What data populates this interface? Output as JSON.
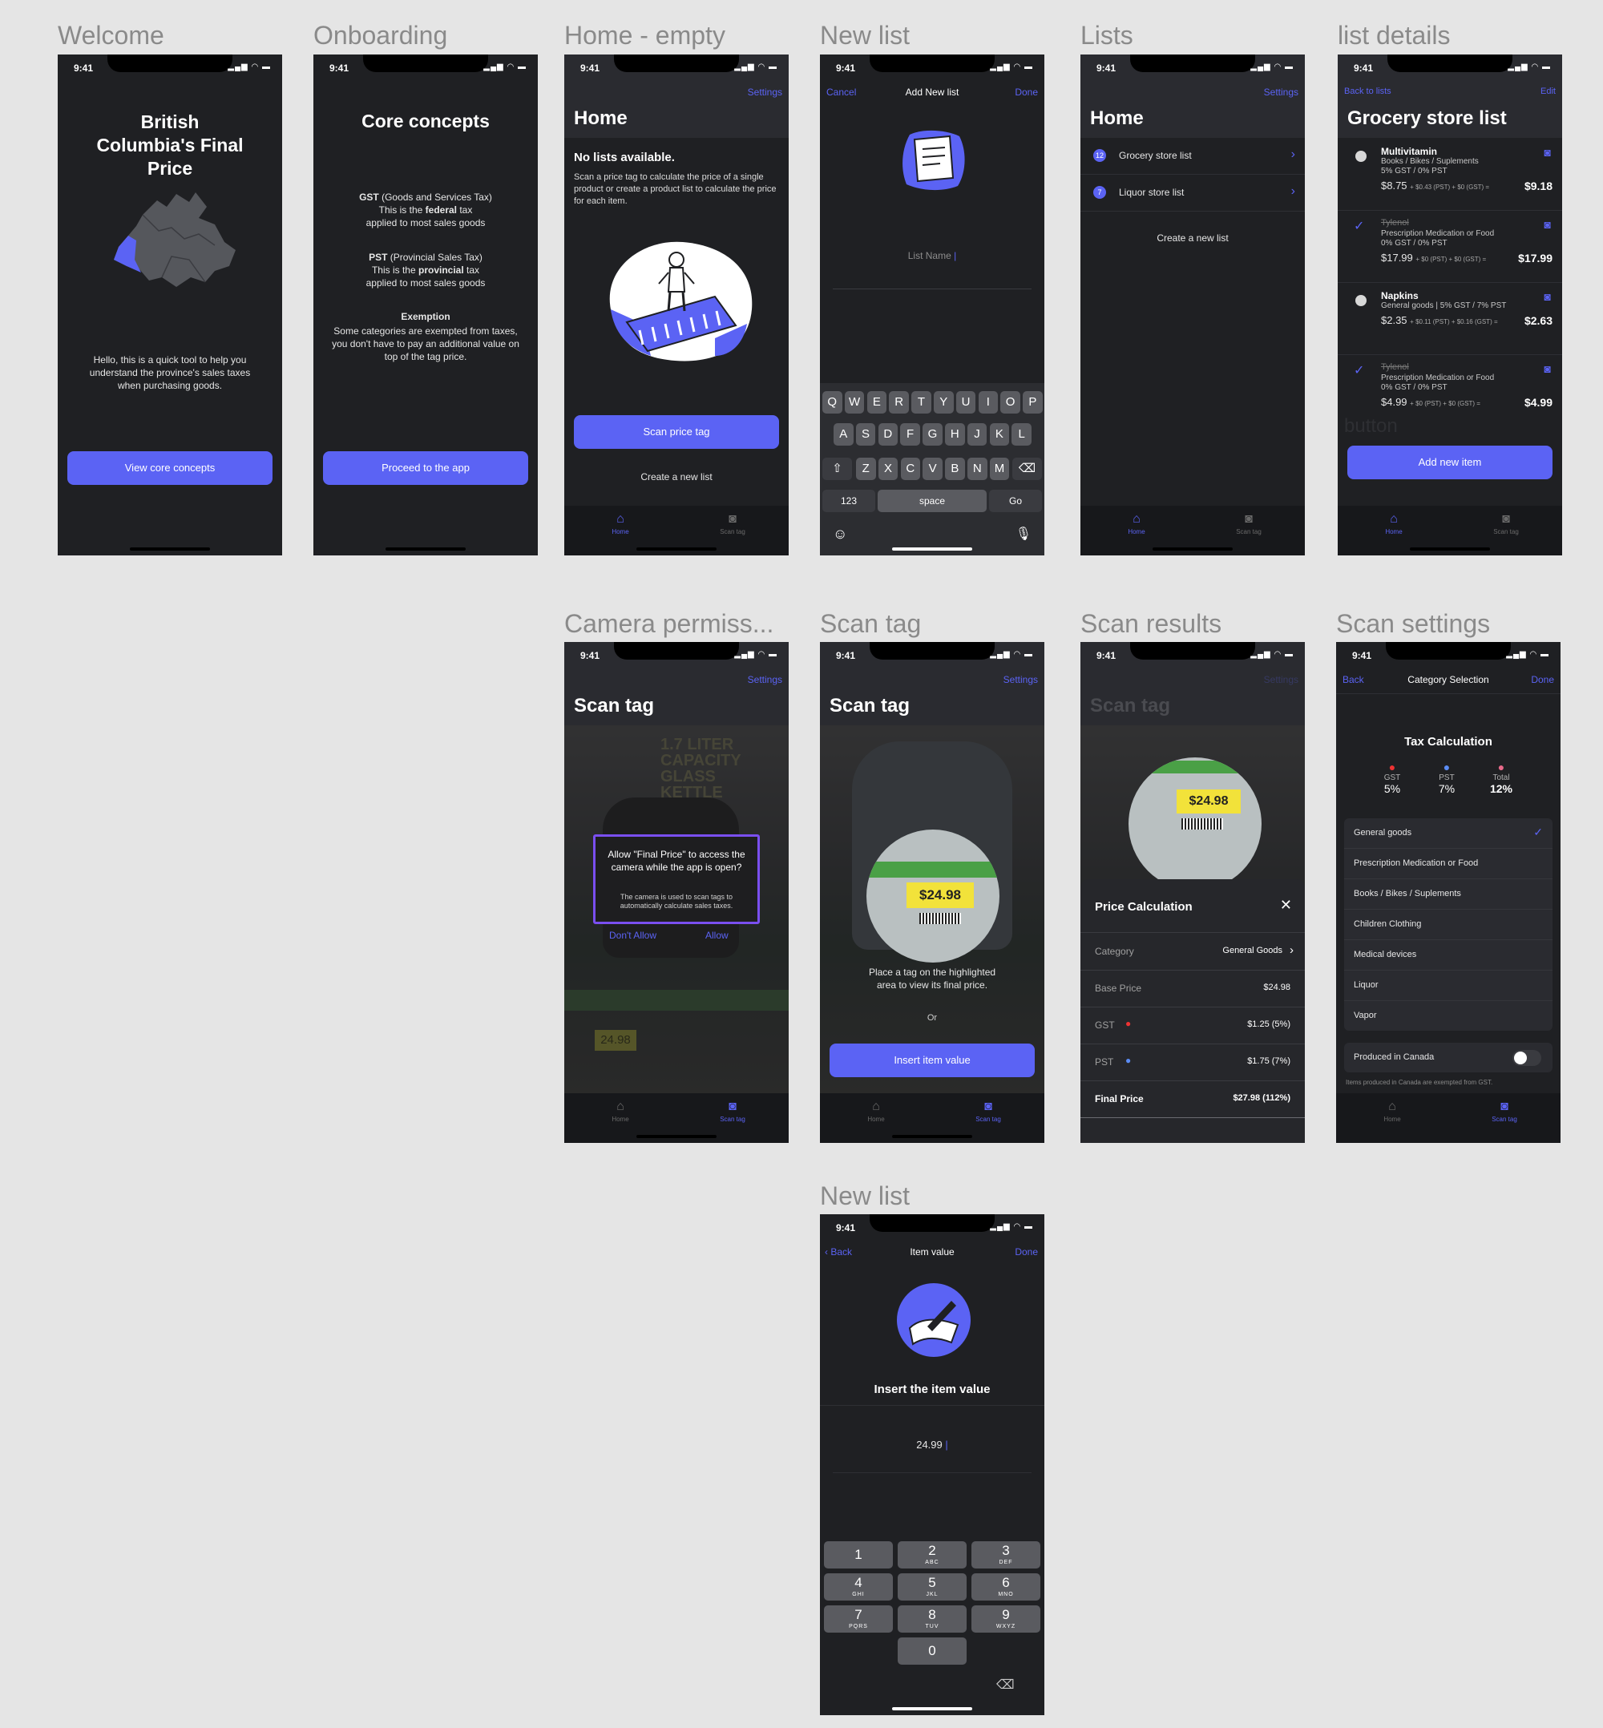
{
  "status_time": "9:41",
  "frames": {
    "welcome": "Welcome",
    "onboarding": "Onboarding",
    "home_empty": "Home - empty",
    "new_list": "New list",
    "lists": "Lists",
    "list_details": "list details",
    "camera_permission": "Camera permiss...",
    "scan_tag": "Scan tag",
    "scan_results": "Scan results",
    "scan_settings": "Scan settings",
    "item_value": "New list"
  },
  "tabs": {
    "home": "Home",
    "scan": "Scan tag"
  },
  "welcome": {
    "title": "British Columbia's Final Price",
    "description": "Hello, this is a quick tool to help you understand the province's sales taxes when purchasing goods.",
    "button": "View core concepts"
  },
  "onboarding": {
    "title": "Core concepts",
    "gst_term": "GST",
    "gst_expansion": "(Goods and Services Tax)",
    "gst_line1_pre": "This is the ",
    "gst_line1_bold": "federal",
    "gst_line1_post": " tax",
    "gst_line2": "applied to most sales goods",
    "pst_term": "PST",
    "pst_expansion": "(Provincial Sales Tax)",
    "pst_line1_pre": "This is the ",
    "pst_line1_bold": "provincial",
    "pst_line1_post": " tax",
    "pst_line2": "applied to most sales goods",
    "exemption_title": "Exemption",
    "exemption_text": "Some categories are exempted from taxes, you don't have to pay an additional value on top of the tag price.",
    "button": "Proceed to the app"
  },
  "home_empty": {
    "settings": "Settings",
    "title": "Home",
    "empty_title": "No lists available.",
    "empty_text": "Scan a price tag to calculate the price of a single product or create a product list to calculate the price for each item.",
    "scan_button": "Scan price tag",
    "create_link": "Create a new list"
  },
  "new_list": {
    "cancel": "Cancel",
    "title": "Add New list",
    "done": "Done",
    "placeholder": "List Name",
    "keyboard_row1": [
      "Q",
      "W",
      "E",
      "R",
      "T",
      "Y",
      "U",
      "I",
      "O",
      "P"
    ],
    "keyboard_row2": [
      "A",
      "S",
      "D",
      "F",
      "G",
      "H",
      "J",
      "K",
      "L"
    ],
    "keyboard_row3": [
      "Z",
      "X",
      "C",
      "V",
      "B",
      "N",
      "M"
    ],
    "key_123": "123",
    "key_space": "space",
    "key_go": "Go"
  },
  "lists": {
    "settings": "Settings",
    "title": "Home",
    "items": [
      {
        "count": "12",
        "name": "Grocery store list"
      },
      {
        "count": "7",
        "name": "Liquor store list"
      }
    ],
    "create_link": "Create a new list"
  },
  "list_details": {
    "back": "Back to lists",
    "edit": "Edit",
    "title": "Grocery store list",
    "items": [
      {
        "name": "Multivitamin",
        "category": "Books / Bikes / Suplements",
        "taxes": "5% GST / 0% PST",
        "base": "$8.75",
        "breakdown": "+ $0.43 (PST) + $0 (GST) =",
        "total": "$9.18",
        "done": false
      },
      {
        "name": "Tylenol",
        "category": "Prescription Medication or Food",
        "taxes": "0% GST / 0% PST",
        "base": "$17.99",
        "breakdown": "+ $0 (PST) + $0 (GST) =",
        "total": "$17.99",
        "done": true
      },
      {
        "name": "Napkins",
        "category": "General goods | 5% GST / 7% PST",
        "taxes": "",
        "base": "$2.35",
        "breakdown": "+ $0.11 (PST) + $0.16 (GST) =",
        "total": "$2.63",
        "done": false
      },
      {
        "name": "Tylenol",
        "category": "Prescription Medication or Food",
        "taxes": "0% GST / 0% PST",
        "base": "$4.99",
        "breakdown": "+ $0 (PST) + $0 (GST) =",
        "total": "$4.99",
        "done": true
      }
    ],
    "ghost_label": "button",
    "add_button": "Add new item"
  },
  "camera_permission": {
    "settings": "Settings",
    "title": "Scan tag",
    "kettle_text": "1.7 LITER CAPACITY GLASS KETTLE",
    "alert_title": "Allow \"Final Price\" to access the camera while the app is open?",
    "alert_text": "The camera is used to scan tags to automatically calculate sales taxes.",
    "dont_allow": "Don't Allow",
    "allow": "Allow",
    "price_tag": "24.98"
  },
  "scan_tag": {
    "settings": "Settings",
    "title": "Scan tag",
    "price_tag": "$24.98",
    "instruction": "Place a tag on the highlighted area to view its final price.",
    "or": "Or",
    "insert_button": "Insert item value"
  },
  "scan_results": {
    "title": "Scan tag",
    "settings": "Settings",
    "price_tag": "$24.98",
    "sheet_title": "Price Calculation",
    "rows": [
      {
        "label": "Category",
        "value": "General Goods"
      },
      {
        "label": "Base Price",
        "value": "$24.98"
      },
      {
        "label": "GST",
        "value": "$1.25 (5%)"
      },
      {
        "label": "PST",
        "value": "$1.75 (7%)"
      },
      {
        "label": "Final Price",
        "value": "$27.98 (112%)"
      }
    ]
  },
  "scan_settings": {
    "back": "Back",
    "title": "Category Selection",
    "done": "Done",
    "heading": "Tax Calculation",
    "gst_label": "GST",
    "gst_value": "5%",
    "pst_label": "PST",
    "pst_value": "7%",
    "total_label": "Total",
    "total_value": "12%",
    "categories": [
      "General goods",
      "Prescription Medication or Food",
      "Books / Bikes / Suplements",
      "Children Clothing",
      "Medical devices",
      "Liquor",
      "Vapor"
    ],
    "selected_index": 0,
    "toggle_label": "Produced in Canada",
    "toggle_on": false,
    "toggle_note": "Items produced in Canada are exempted from GST."
  },
  "item_value": {
    "back": "Back",
    "title": "Item value",
    "done": "Done",
    "heading": "Insert the item value",
    "value": "24.99",
    "keys": [
      {
        "n": "1",
        "l": ""
      },
      {
        "n": "2",
        "l": "ABC"
      },
      {
        "n": "3",
        "l": "DEF"
      },
      {
        "n": "4",
        "l": "GHI"
      },
      {
        "n": "5",
        "l": "JKL"
      },
      {
        "n": "6",
        "l": "MNO"
      },
      {
        "n": "7",
        "l": "PQRS"
      },
      {
        "n": "8",
        "l": "TUV"
      },
      {
        "n": "9",
        "l": "WXYZ"
      },
      {
        "n": "0",
        "l": ""
      }
    ]
  },
  "colors": {
    "accent": "#5b63f4",
    "background": "#1f2023",
    "canvas": "#e5e5e5"
  }
}
